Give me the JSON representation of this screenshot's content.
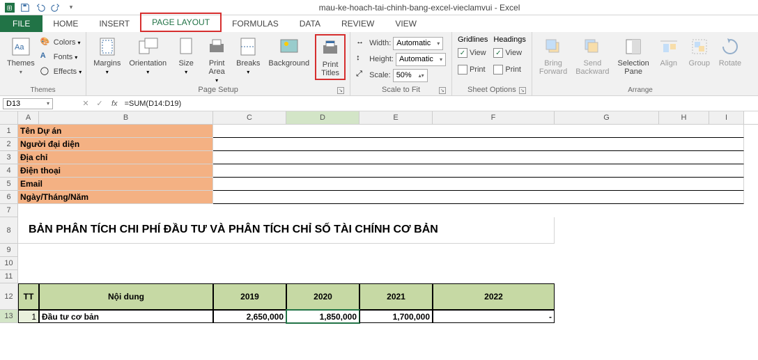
{
  "app": {
    "title": "mau-ke-hoach-tai-chinh-bang-excel-vieclamvui - Excel"
  },
  "tabs": {
    "file": "FILE",
    "home": "HOME",
    "insert": "INSERT",
    "pagelayout": "PAGE LAYOUT",
    "formulas": "FORMULAS",
    "data": "DATA",
    "review": "REVIEW",
    "view": "VIEW"
  },
  "ribbon": {
    "themes": {
      "themes": "Themes",
      "colors": "Colors",
      "fonts": "Fonts",
      "effects": "Effects",
      "label": "Themes"
    },
    "pagesetup": {
      "margins": "Margins",
      "orientation": "Orientation",
      "size": "Size",
      "printarea": "Print\nArea",
      "breaks": "Breaks",
      "background": "Background",
      "printtitles": "Print\nTitles",
      "label": "Page Setup"
    },
    "scale": {
      "width": "Width:",
      "height": "Height:",
      "scale": "Scale:",
      "auto": "Automatic",
      "pct": "50%",
      "label": "Scale to Fit"
    },
    "sheet": {
      "gridlines": "Gridlines",
      "headings": "Headings",
      "view": "View",
      "print": "Print",
      "label": "Sheet Options"
    },
    "arrange": {
      "bringfw": "Bring\nForward",
      "sendbw": "Send\nBackward",
      "selpane": "Selection\nPane",
      "align": "Align",
      "group": "Group",
      "rotate": "Rotate",
      "label": "Arrange"
    }
  },
  "fbar": {
    "name": "D13",
    "formula": "=SUM(D14:D19)"
  },
  "cols": {
    "A": "A",
    "B": "B",
    "C": "C",
    "D": "D",
    "E": "E",
    "F": "F",
    "G": "G",
    "H": "H",
    "I": "I"
  },
  "rows": [
    "1",
    "2",
    "3",
    "4",
    "5",
    "6",
    "7",
    "8",
    "9",
    "10",
    "11",
    "12",
    "13"
  ],
  "sheet": {
    "r1": "Tên Dự án",
    "r2": "Người đại diện",
    "r3": "Địa chỉ",
    "r4": "Điện thoại",
    "r5": "Email",
    "r6": "Ngày/Tháng/Năm",
    "title": "BẢN PHÂN TÍCH CHI PHÍ ĐẦU TƯ VÀ PHÂN TÍCH CHỈ SỐ TÀI CHÍNH CƠ BẢN",
    "h_tt": "TT",
    "h_nd": "Nội dung",
    "h_2019": "2019",
    "h_2020": "2020",
    "h_2021": "2021",
    "h_2022": "2022",
    "d_tt": "1",
    "d_nd": "Đầu tư cơ bản",
    "d_19": "2,650,000",
    "d_20": "1,850,000",
    "d_21": "1,700,000",
    "d_22": "-"
  }
}
